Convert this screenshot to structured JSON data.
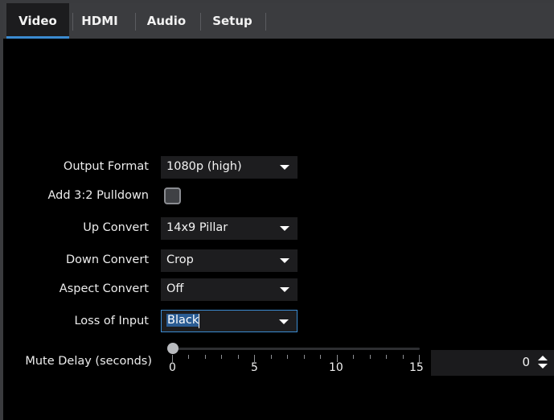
{
  "tabs": [
    {
      "label": "Video",
      "active": true
    },
    {
      "label": "HDMI",
      "active": false
    },
    {
      "label": "Audio",
      "active": false
    },
    {
      "label": "Setup",
      "active": false
    }
  ],
  "fields": {
    "output_format": {
      "label": "Output Format",
      "value": "1080p (high)"
    },
    "add_pulldown": {
      "label": "Add 3:2 Pulldown",
      "checked": false
    },
    "up_convert": {
      "label": "Up Convert",
      "value": "14x9 Pillar"
    },
    "down_convert": {
      "label": "Down Convert",
      "value": "Crop"
    },
    "aspect_convert": {
      "label": "Aspect Convert",
      "value": "Off"
    },
    "loss_of_input": {
      "label": "Loss of Input",
      "value": "Black"
    }
  },
  "mute_delay": {
    "label": "Mute Delay (seconds)",
    "value": "0",
    "slider_value": 0,
    "slider_min": 0,
    "slider_max": 15,
    "tick_labels": [
      "0",
      "5",
      "10",
      "15"
    ]
  },
  "colors": {
    "accent": "#3b8bd1",
    "background": "#000000",
    "tabbar": "#3b3c3f"
  }
}
